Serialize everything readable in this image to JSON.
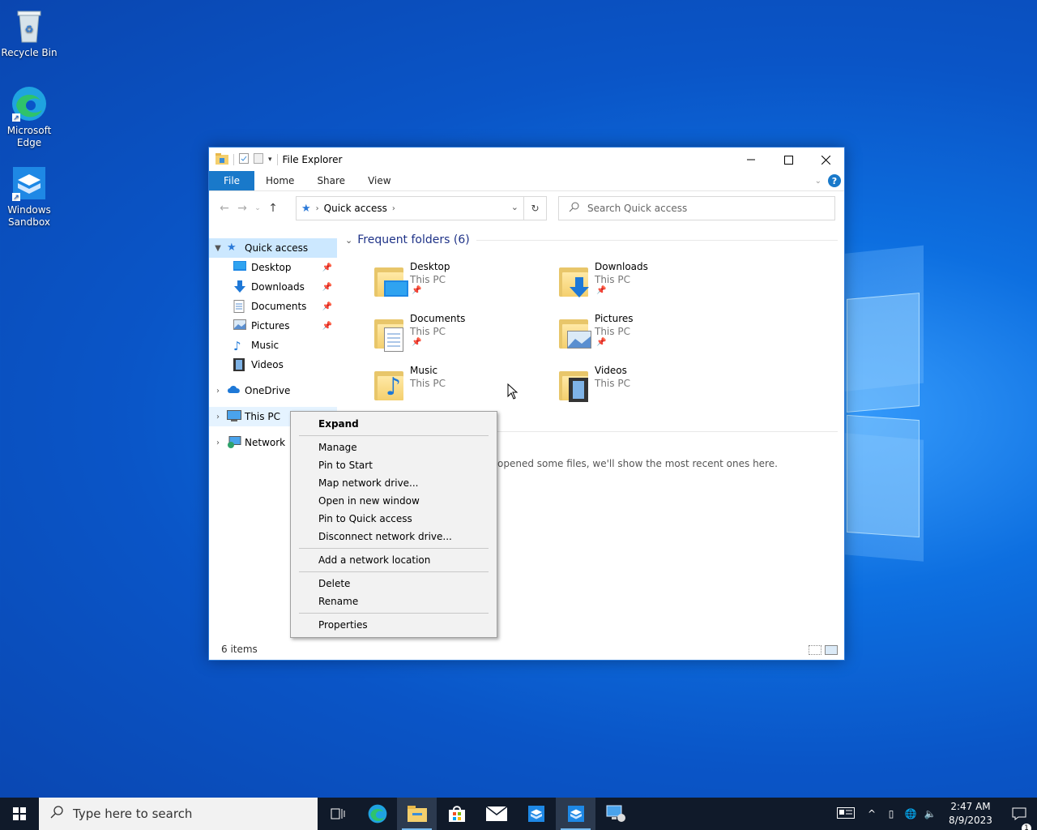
{
  "desktop": {
    "icons": [
      {
        "label": "Recycle Bin"
      },
      {
        "label": "Microsoft Edge"
      },
      {
        "label": "Windows Sandbox"
      }
    ]
  },
  "window": {
    "title": "File Explorer",
    "ribbon_tabs": [
      "File",
      "Home",
      "Share",
      "View"
    ],
    "help_label": "?",
    "address": {
      "path": "Quick access"
    },
    "search": {
      "placeholder": "Search Quick access"
    },
    "nav": {
      "quick_access": "Quick access",
      "qa_items": [
        "Desktop",
        "Downloads",
        "Documents",
        "Pictures",
        "Music",
        "Videos"
      ],
      "onedrive": "OneDrive",
      "this_pc": "This PC",
      "network": "Network"
    },
    "content": {
      "group_title": "Frequent folders (6)",
      "folders": [
        {
          "name": "Desktop",
          "location": "This PC"
        },
        {
          "name": "Downloads",
          "location": "This PC"
        },
        {
          "name": "Documents",
          "location": "This PC"
        },
        {
          "name": "Pictures",
          "location": "This PC"
        },
        {
          "name": "Music",
          "location": "This PC"
        },
        {
          "name": "Videos",
          "location": "This PC"
        }
      ],
      "recent_message": "opened some files, we'll show the most recent ones here."
    },
    "status": "6 items"
  },
  "context_menu": {
    "items": [
      "Expand",
      "Manage",
      "Pin to Start",
      "Map network drive...",
      "Open in new window",
      "Pin to Quick access",
      "Disconnect network drive...",
      "Add a network location",
      "Delete",
      "Rename",
      "Properties"
    ]
  },
  "taskbar": {
    "search_placeholder": "Type here to search",
    "time": "2:47 AM",
    "date": "8/9/2023",
    "notification_count": "1"
  },
  "colors": {
    "accent": "#1979ca",
    "selection": "#cce8ff",
    "taskbar": "#101a2a"
  }
}
